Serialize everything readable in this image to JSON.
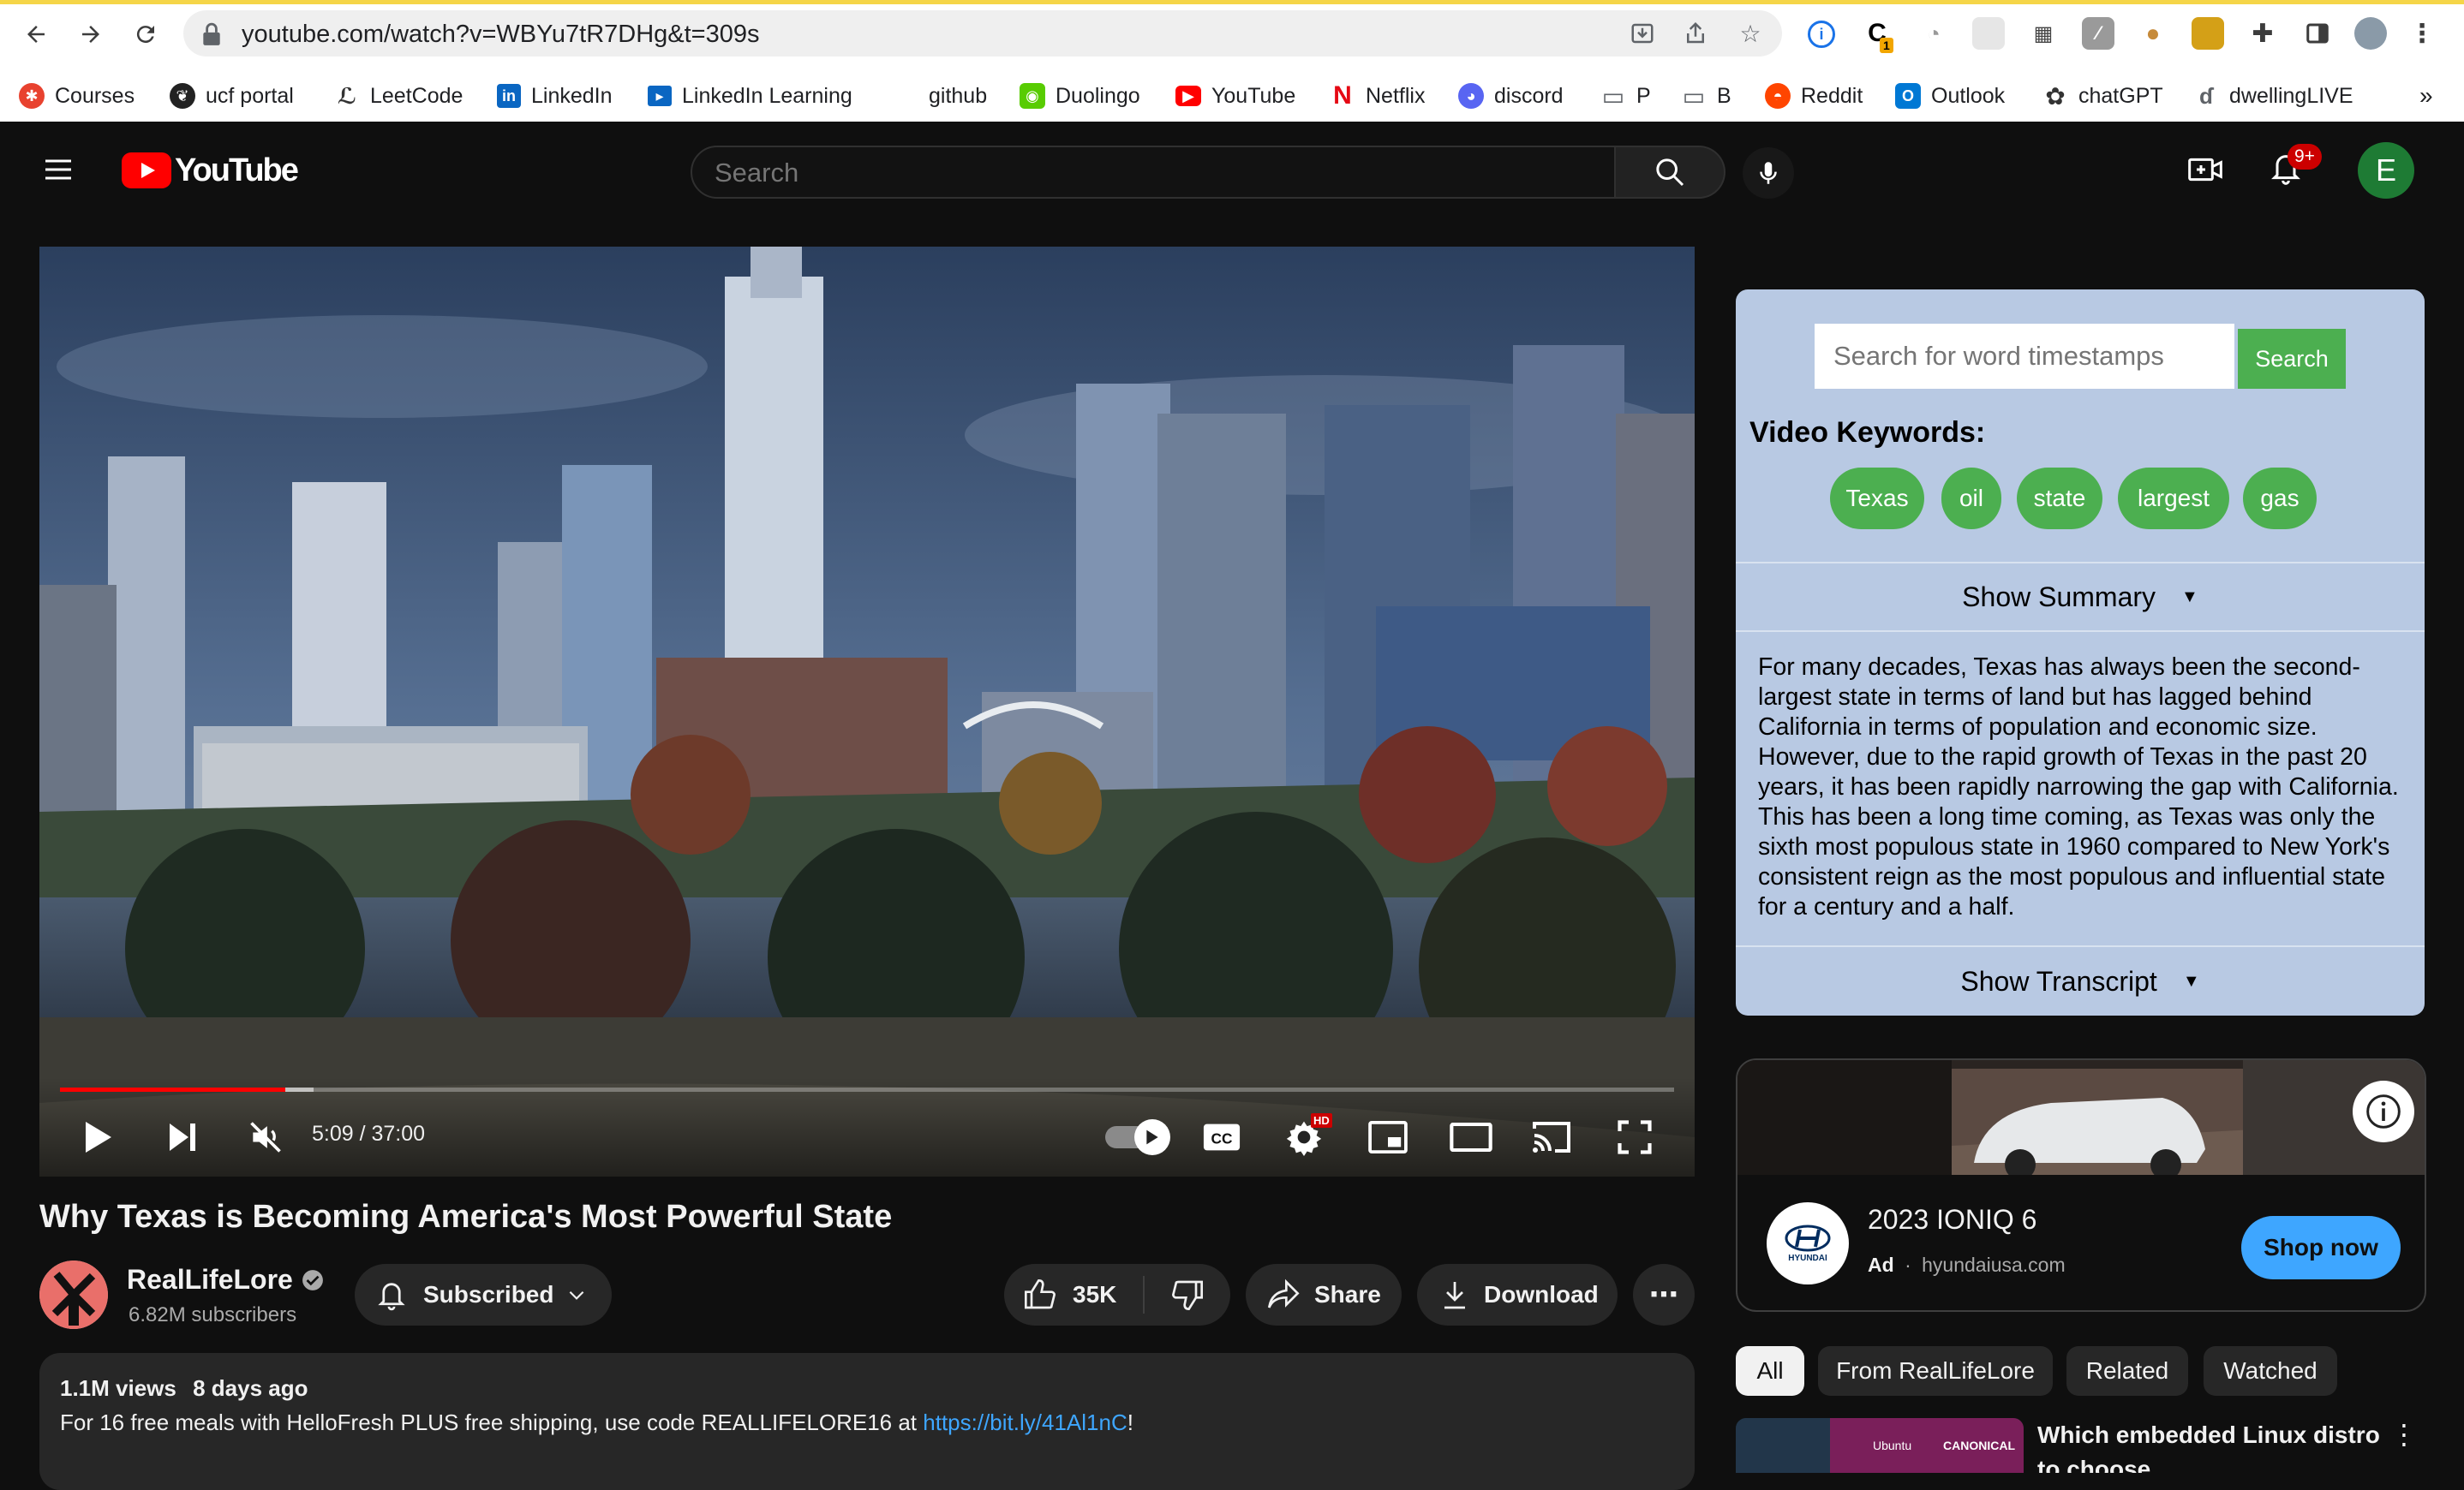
{
  "browser": {
    "url": "youtube.com/watch?v=WBYu7tR7DHg&t=309s",
    "extension_badge": "1",
    "bookmarks": [
      {
        "label": "Courses",
        "icon": "ucf-icon",
        "color": "#e8422f"
      },
      {
        "label": "ucf portal",
        "icon": "pegasus-icon",
        "color": "#222222"
      },
      {
        "label": "LeetCode",
        "icon": "leetcode-icon",
        "color": "#ffa116"
      },
      {
        "label": "LinkedIn",
        "icon": "linkedin-icon",
        "color": "#0a66c2"
      },
      {
        "label": "LinkedIn Learning",
        "icon": "linkedin-learning-icon",
        "color": "#0a66c2"
      },
      {
        "label": "github",
        "icon": "",
        "color": ""
      },
      {
        "label": "Duolingo",
        "icon": "duolingo-icon",
        "color": "#58cc02"
      },
      {
        "label": "YouTube",
        "icon": "youtube-icon",
        "color": "#ff0000"
      },
      {
        "label": "Netflix",
        "icon": "netflix-icon",
        "color": "#e50914"
      },
      {
        "label": "discord",
        "icon": "discord-icon",
        "color": "#5865f2"
      },
      {
        "label": "P",
        "icon": "folder-icon",
        "color": "#5f6368"
      },
      {
        "label": "B",
        "icon": "folder-icon",
        "color": "#5f6368"
      },
      {
        "label": "Reddit",
        "icon": "reddit-icon",
        "color": "#ff4500"
      },
      {
        "label": "Outlook",
        "icon": "outlook-icon",
        "color": "#0078d4"
      },
      {
        "label": "chatGPT",
        "icon": "chatgpt-icon",
        "color": "#10a37f"
      },
      {
        "label": "dwellingLIVE",
        "icon": "dwelling-icon",
        "color": "#5f6368"
      }
    ],
    "bookmarks_overflow": "»"
  },
  "youtube": {
    "logo_text": "YouTube",
    "search_placeholder": "Search",
    "notifications_badge": "9+",
    "avatar_letter": "E",
    "avatar_color": "#1e7b34"
  },
  "player": {
    "progress_fraction": 0.1394,
    "buffered_fraction": 0.1573,
    "time_display": "5:09 / 37:00",
    "hd_badge": "HD"
  },
  "video": {
    "title": "Why Texas is Becoming America's Most Powerful State",
    "channel_name": "RealLifeLore",
    "subscribers": "6.82M subscribers",
    "subscribe_label": "Subscribed",
    "likes": "35K",
    "share_label": "Share",
    "download_label": "Download",
    "views": "1.1M views",
    "age": "8 days ago",
    "description_prefix": "For 16 free meals with HelloFresh PLUS free shipping, use code REALLIFELORE16 at ",
    "description_link": "https://bit.ly/41Al1nC",
    "description_suffix": "!"
  },
  "extension": {
    "search_placeholder": "Search for word timestamps",
    "search_button": "Search",
    "keywords_heading": "Video Keywords:",
    "keywords": [
      "Texas",
      "oil",
      "state",
      "largest",
      "gas"
    ],
    "summary_toggle": "Show Summary",
    "summary_text": "For many decades, Texas has always been the second-largest state in terms of land but has lagged behind California in terms of population and economic size. However, due to the rapid growth of Texas in the past 20 years, it has been rapidly narrowing the gap with California. This has been a long time coming, as Texas was only the sixth most populous state in 1960 compared to New York's consistent reign as the most populous and influential state for a century and a half.",
    "transcript_toggle": "Show Transcript"
  },
  "ad": {
    "brand_logo_text": "HYUNDAI",
    "title": "2023 IONIQ 6",
    "label": "Ad",
    "domain": "hyundaiusa.com",
    "cta": "Shop now"
  },
  "filter_chips": [
    "All",
    "From RealLifeLore",
    "Related",
    "Watched"
  ],
  "recommendation": {
    "title": "Which embedded Linux distro to choose",
    "thumb_text_1": "Ubuntu",
    "thumb_text_2": "CANONICAL"
  }
}
